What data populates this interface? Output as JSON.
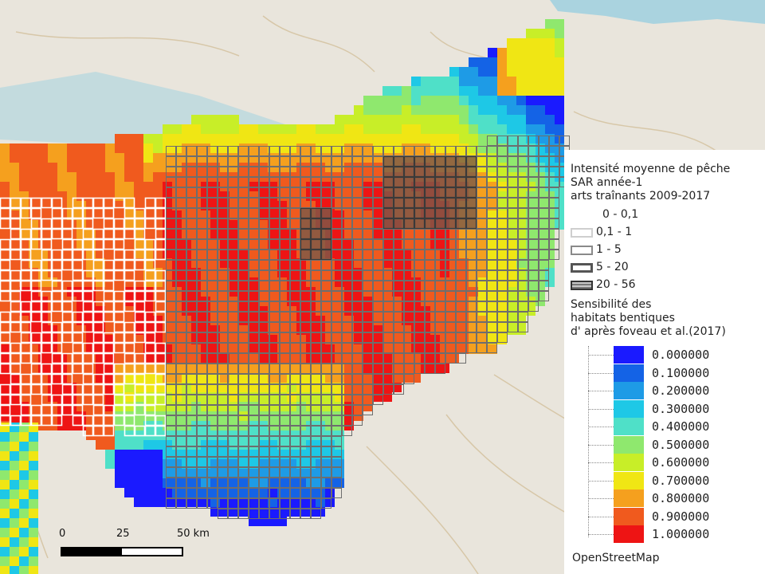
{
  "map": {
    "basemap": "OpenStreetMap",
    "sea_color": "#aad3df",
    "land_color": "#e9e5dc"
  },
  "legend": {
    "title_lines": [
      "Intensité moyenne de pêche",
      "SAR année-1",
      "arts traînants 2009-2017"
    ],
    "intensity_classes": [
      {
        "label": "0 - 0,1",
        "style": "none"
      },
      {
        "label": "0,1 - 1",
        "style": "white"
      },
      {
        "label": "1 - 5",
        "style": "grey-thin"
      },
      {
        "label": "5 - 20",
        "style": "grey-thick"
      },
      {
        "label": "20 - 56",
        "style": "hatched"
      }
    ],
    "sensitivity_title_lines": [
      "Sensibilité des",
      "habitats bentiques",
      "d' après foveau et al.(2017)"
    ],
    "sensitivity_ramp": [
      {
        "value": "0.000000",
        "color": "#1a1aff"
      },
      {
        "value": "0.100000",
        "color": "#1463e6"
      },
      {
        "value": "0.200000",
        "color": "#1e9be6"
      },
      {
        "value": "0.300000",
        "color": "#1ec8e6"
      },
      {
        "value": "0.400000",
        "color": "#4fe0c8"
      },
      {
        "value": "0.500000",
        "color": "#8fe86e"
      },
      {
        "value": "0.600000",
        "color": "#c8ee28"
      },
      {
        "value": "0.700000",
        "color": "#f0e614"
      },
      {
        "value": "0.800000",
        "color": "#f5a01e"
      },
      {
        "value": "0.900000",
        "color": "#f05a1e"
      },
      {
        "value": "1.000000",
        "color": "#ee1414"
      }
    ]
  },
  "attribution": "OpenStreetMap",
  "scalebar": {
    "labels": [
      "0",
      "25",
      "50 km"
    ]
  }
}
